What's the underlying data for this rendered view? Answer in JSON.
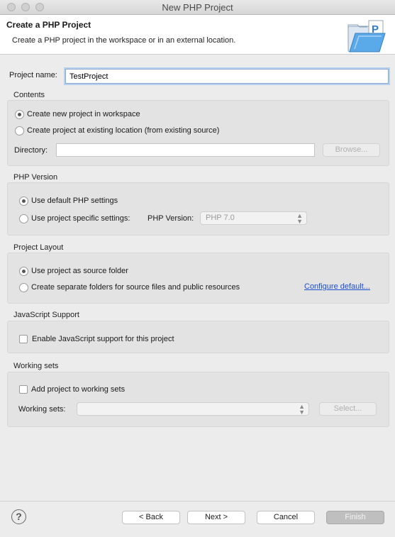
{
  "window": {
    "title": "New PHP Project"
  },
  "header": {
    "title": "Create a PHP Project",
    "description": "Create a PHP project in the workspace or in an external location.",
    "icon": "php-project-folder-icon"
  },
  "project_name": {
    "label": "Project name:",
    "value": "TestProject"
  },
  "contents": {
    "title": "Contents",
    "option_new": "Create new project in workspace",
    "option_existing": "Create project at existing location (from existing source)",
    "selected": "option_new",
    "directory_label": "Directory:",
    "directory_value": "",
    "browse_label": "Browse..."
  },
  "php_version": {
    "title": "PHP Version",
    "option_default": "Use default PHP settings",
    "option_specific": "Use project specific settings:",
    "selected": "option_default",
    "version_label": "PHP Version:",
    "version_value": "PHP 7.0"
  },
  "project_layout": {
    "title": "Project Layout",
    "option_source": "Use project as source folder",
    "option_separate": "Create separate folders for source files and public resources",
    "selected": "option_source",
    "configure_link": "Configure default..."
  },
  "javascript_support": {
    "title": "JavaScript Support",
    "checkbox_label": "Enable JavaScript support for this project",
    "checked": false
  },
  "working_sets": {
    "title": "Working sets",
    "checkbox_label": "Add project to working sets",
    "checked": false,
    "sets_label": "Working sets:",
    "sets_value": "",
    "select_label": "Select..."
  },
  "footer": {
    "back": "< Back",
    "next": "Next >",
    "cancel": "Cancel",
    "finish": "Finish",
    "help": "?"
  }
}
